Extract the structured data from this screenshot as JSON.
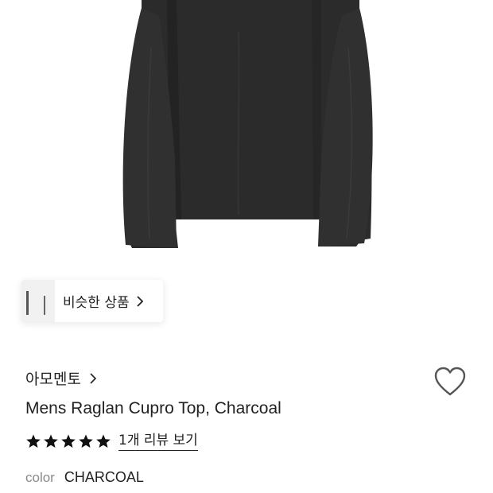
{
  "similar_products": {
    "label": "비슷한 상품"
  },
  "product": {
    "brand": "아모멘토",
    "name": "Mens Raglan Cupro Top, Charcoal",
    "rating": {
      "stars": 5,
      "max_stars": 5,
      "review_link": "1개 리뷰 보기"
    },
    "attribute": {
      "label": "color",
      "value": "CHARCOAL"
    }
  },
  "colors": {
    "garment": "#2b2b2b",
    "text": "#222222",
    "muted": "#8a8a8a"
  },
  "icons": {
    "wishlist": "heart-icon",
    "star": "star-icon",
    "chevron": "chevron-right-icon"
  }
}
